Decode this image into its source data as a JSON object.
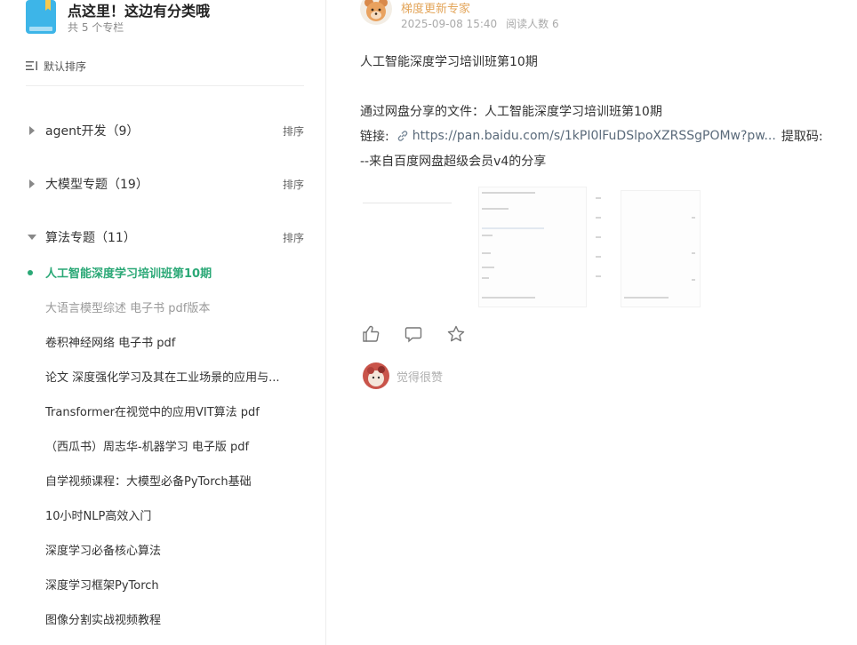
{
  "column": {
    "title": "点这里！这边有分类哦",
    "count_text": "共 5 个专栏",
    "icon": "book-icon",
    "accent": "#3db5e8"
  },
  "sort": {
    "label": "默认排序",
    "icon": "sort-lines-icon"
  },
  "categories": [
    {
      "name": "agent开发（9）",
      "sort_label": "排序",
      "expanded": false
    },
    {
      "name": "大模型专题（19）",
      "sort_label": "排序",
      "expanded": false
    },
    {
      "name": "算法专题（11）",
      "sort_label": "排序",
      "expanded": true
    }
  ],
  "articles": [
    {
      "title": "人工智能深度学习培训班第10期",
      "state": "active"
    },
    {
      "title": "大语言模型综述 电子书 pdf版本",
      "state": "faded"
    },
    {
      "title": "卷积神经网络 电子书 pdf",
      "state": "normal"
    },
    {
      "title": "论文 深度强化学习及其在工业场景的应用与...",
      "state": "normal"
    },
    {
      "title": "Transformer在视觉中的应用VIT算法 pdf",
      "state": "normal"
    },
    {
      "title": "（西瓜书）周志华-机器学习 电子版 pdf",
      "state": "normal"
    },
    {
      "title": "自学视频课程：大模型必备PyTorch基础",
      "state": "normal"
    },
    {
      "title": "10小时NLP高效入门",
      "state": "normal"
    },
    {
      "title": "深度学习必备核心算法",
      "state": "normal"
    },
    {
      "title": "深度学习框架PyTorch",
      "state": "normal"
    },
    {
      "title": "图像分割实战视频教程",
      "state": "normal"
    }
  ],
  "post": {
    "author": "梯度更新专家",
    "date": "2025-09-08 15:40",
    "reads": "阅读人数 6",
    "title_line": "人工智能深度学习培训班第10期",
    "share_line": "通过网盘分享的文件：人工智能深度学习培训班第10期",
    "link_label": "链接:",
    "link_url": "https://pan.baidu.com/s/1kPI0lFuDSlpoXZRSSgPOMw?pw...",
    "code_label": "提取码:",
    "footer_line": "--来自百度网盘超级会员v4的分享",
    "author_color": "#e3a55a",
    "active_color": "#2aa876"
  },
  "liker": {
    "name": "觉得很赞"
  }
}
